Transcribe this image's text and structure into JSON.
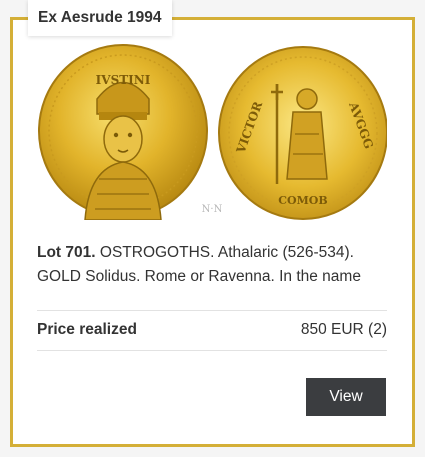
{
  "provenance_badge": "Ex Aesrude 1994",
  "coin_image": {
    "watermark": "N·N",
    "obverse_legend": "DN IVSTINIANVS PF AVG",
    "reverse_legend": "VICTORIA AVGGG",
    "exergue": "COMOB"
  },
  "lot": {
    "number_label": "Lot 701.",
    "description": " OSTROGOTHS. Athalaric (526-534). GOLD Solidus. Rome or Ravenna. In the name"
  },
  "price": {
    "label": "Price realized",
    "value": "850 EUR (2)"
  },
  "view_button": "View",
  "colors": {
    "frame": "#d4af37",
    "button": "#3b3d40",
    "gold": "#e0b52a"
  }
}
